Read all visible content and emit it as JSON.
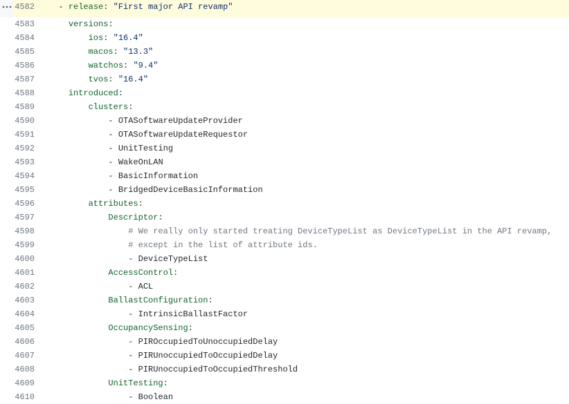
{
  "first_line_number": 4582,
  "lines": [
    {
      "highlighted": true,
      "indent": 2,
      "tokens": [
        {
          "t": "dash",
          "v": "- "
        },
        {
          "t": "key",
          "v": "release"
        },
        {
          "t": "plain",
          "v": ": "
        },
        {
          "t": "str",
          "v": "\"First major API revamp\""
        }
      ]
    },
    {
      "indent": 4,
      "tokens": [
        {
          "t": "key",
          "v": "versions"
        },
        {
          "t": "plain",
          "v": ":"
        }
      ]
    },
    {
      "indent": 8,
      "tokens": [
        {
          "t": "key",
          "v": "ios"
        },
        {
          "t": "plain",
          "v": ": "
        },
        {
          "t": "str",
          "v": "\"16.4\""
        }
      ]
    },
    {
      "indent": 8,
      "tokens": [
        {
          "t": "key",
          "v": "macos"
        },
        {
          "t": "plain",
          "v": ": "
        },
        {
          "t": "str",
          "v": "\"13.3\""
        }
      ]
    },
    {
      "indent": 8,
      "tokens": [
        {
          "t": "key",
          "v": "watchos"
        },
        {
          "t": "plain",
          "v": ": "
        },
        {
          "t": "str",
          "v": "\"9.4\""
        }
      ]
    },
    {
      "indent": 8,
      "tokens": [
        {
          "t": "key",
          "v": "tvos"
        },
        {
          "t": "plain",
          "v": ": "
        },
        {
          "t": "str",
          "v": "\"16.4\""
        }
      ]
    },
    {
      "indent": 4,
      "tokens": [
        {
          "t": "key",
          "v": "introduced"
        },
        {
          "t": "plain",
          "v": ":"
        }
      ]
    },
    {
      "indent": 8,
      "tokens": [
        {
          "t": "key",
          "v": "clusters"
        },
        {
          "t": "plain",
          "v": ":"
        }
      ]
    },
    {
      "indent": 12,
      "tokens": [
        {
          "t": "dash",
          "v": "- "
        },
        {
          "t": "plain",
          "v": "OTASoftwareUpdateProvider"
        }
      ]
    },
    {
      "indent": 12,
      "tokens": [
        {
          "t": "dash",
          "v": "- "
        },
        {
          "t": "plain",
          "v": "OTASoftwareUpdateRequestor"
        }
      ]
    },
    {
      "indent": 12,
      "tokens": [
        {
          "t": "dash",
          "v": "- "
        },
        {
          "t": "plain",
          "v": "UnitTesting"
        }
      ]
    },
    {
      "indent": 12,
      "tokens": [
        {
          "t": "dash",
          "v": "- "
        },
        {
          "t": "plain",
          "v": "WakeOnLAN"
        }
      ]
    },
    {
      "indent": 12,
      "tokens": [
        {
          "t": "dash",
          "v": "- "
        },
        {
          "t": "plain",
          "v": "BasicInformation"
        }
      ]
    },
    {
      "indent": 12,
      "tokens": [
        {
          "t": "dash",
          "v": "- "
        },
        {
          "t": "plain",
          "v": "BridgedDeviceBasicInformation"
        }
      ]
    },
    {
      "indent": 8,
      "tokens": [
        {
          "t": "key",
          "v": "attributes"
        },
        {
          "t": "plain",
          "v": ":"
        }
      ]
    },
    {
      "indent": 12,
      "tokens": [
        {
          "t": "key",
          "v": "Descriptor"
        },
        {
          "t": "plain",
          "v": ":"
        }
      ]
    },
    {
      "indent": 16,
      "tokens": [
        {
          "t": "comment",
          "v": "# We really only started treating DeviceTypeList as DeviceTypeList in the API revamp,"
        }
      ]
    },
    {
      "indent": 16,
      "tokens": [
        {
          "t": "comment",
          "v": "# except in the list of attribute ids."
        }
      ]
    },
    {
      "indent": 16,
      "tokens": [
        {
          "t": "dash",
          "v": "- "
        },
        {
          "t": "plain",
          "v": "DeviceTypeList"
        }
      ]
    },
    {
      "indent": 12,
      "tokens": [
        {
          "t": "key",
          "v": "AccessControl"
        },
        {
          "t": "plain",
          "v": ":"
        }
      ]
    },
    {
      "indent": 16,
      "tokens": [
        {
          "t": "dash",
          "v": "- "
        },
        {
          "t": "plain",
          "v": "ACL"
        }
      ]
    },
    {
      "indent": 12,
      "tokens": [
        {
          "t": "key",
          "v": "BallastConfiguration"
        },
        {
          "t": "plain",
          "v": ":"
        }
      ]
    },
    {
      "indent": 16,
      "tokens": [
        {
          "t": "dash",
          "v": "- "
        },
        {
          "t": "plain",
          "v": "IntrinsicBallastFactor"
        }
      ]
    },
    {
      "indent": 12,
      "tokens": [
        {
          "t": "key",
          "v": "OccupancySensing"
        },
        {
          "t": "plain",
          "v": ":"
        }
      ]
    },
    {
      "indent": 16,
      "tokens": [
        {
          "t": "dash",
          "v": "- "
        },
        {
          "t": "plain",
          "v": "PIROccupiedToUnoccupiedDelay"
        }
      ]
    },
    {
      "indent": 16,
      "tokens": [
        {
          "t": "dash",
          "v": "- "
        },
        {
          "t": "plain",
          "v": "PIRUnoccupiedToOccupiedDelay"
        }
      ]
    },
    {
      "indent": 16,
      "tokens": [
        {
          "t": "dash",
          "v": "- "
        },
        {
          "t": "plain",
          "v": "PIRUnoccupiedToOccupiedThreshold"
        }
      ]
    },
    {
      "indent": 12,
      "tokens": [
        {
          "t": "key",
          "v": "UnitTesting"
        },
        {
          "t": "plain",
          "v": ":"
        }
      ]
    },
    {
      "indent": 16,
      "tokens": [
        {
          "t": "dash",
          "v": "- "
        },
        {
          "t": "plain",
          "v": "Boolean"
        }
      ]
    }
  ],
  "expand_icon_name": "expand-dots-icon"
}
